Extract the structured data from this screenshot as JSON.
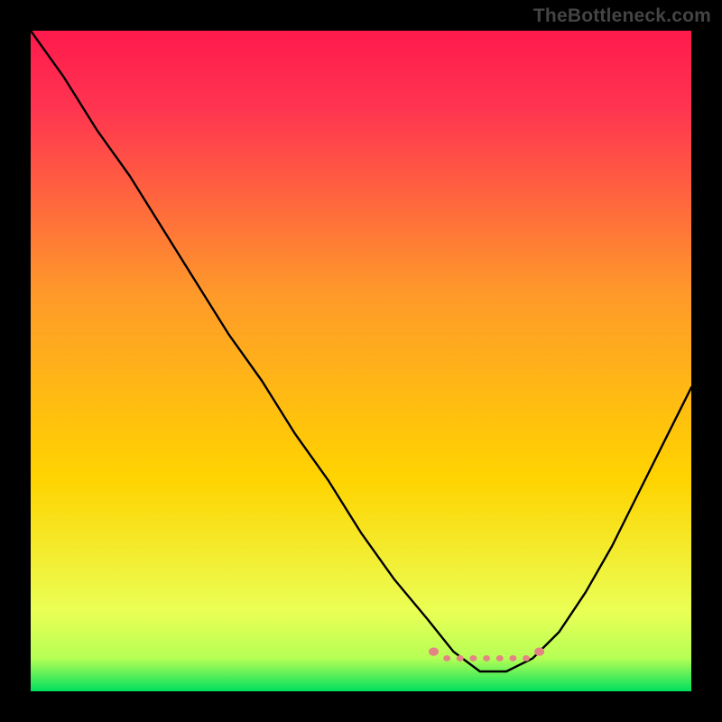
{
  "watermark": "TheBottleneck.com",
  "chart_data": {
    "type": "line",
    "title": "",
    "xlabel": "",
    "ylabel": "",
    "xlim": [
      0,
      100
    ],
    "ylim": [
      0,
      100
    ],
    "grid": false,
    "legend": false,
    "background": {
      "top_color": "#ff1a4d",
      "mid_color": "#ffd400",
      "bottom_color": "#00e05e"
    },
    "series": [
      {
        "name": "bottleneck-curve",
        "color": "#000000",
        "x": [
          0,
          5,
          10,
          15,
          20,
          25,
          30,
          35,
          40,
          45,
          50,
          55,
          60,
          64,
          68,
          72,
          76,
          80,
          84,
          88,
          92,
          96,
          100
        ],
        "values": [
          100,
          93,
          85,
          78,
          70,
          62,
          54,
          47,
          39,
          32,
          24,
          17,
          11,
          6,
          3,
          3,
          5,
          9,
          15,
          22,
          30,
          38,
          46
        ]
      },
      {
        "name": "sweet-spot-underline",
        "color": "#e38585",
        "x": [
          61,
          63,
          65,
          67,
          69,
          71,
          73,
          75,
          77
        ],
        "values": [
          6,
          5,
          5,
          5,
          5,
          5,
          5,
          5,
          6
        ]
      }
    ],
    "sweet_spot_range": [
      61,
      77
    ]
  }
}
